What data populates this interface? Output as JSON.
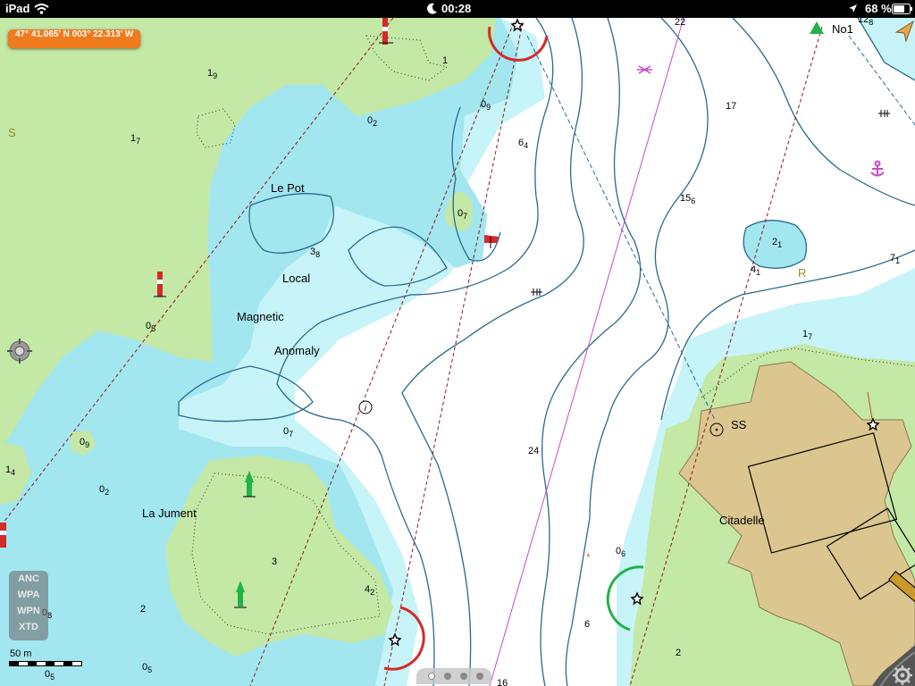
{
  "status_bar": {
    "device": "iPad",
    "time": "00:28",
    "battery": "68 %",
    "icons": [
      "wifi-icon",
      "moon-icon",
      "location-arrow-icon",
      "battery-icon"
    ]
  },
  "coordinates": "47° 41.065' N 003° 22.313' W",
  "map_labels": {
    "le_pot": "Le Pot",
    "local": "Local",
    "magnetic": "Magnetic",
    "anomaly": "Anomaly",
    "la_jument": "La Jument",
    "citadelle": "Citadelle",
    "ss": "SS",
    "no1": "No1",
    "s": "S",
    "r": "R"
  },
  "depths": [
    {
      "main": "1",
      "sub": "9"
    },
    {
      "main": "1",
      "sub": ""
    },
    {
      "main": "1",
      "sub": "7"
    },
    {
      "main": "0",
      "sub": "2"
    },
    {
      "main": "0",
      "sub": "9"
    },
    {
      "main": "6",
      "sub": "4"
    },
    {
      "main": "0",
      "sub": "7"
    },
    {
      "main": "3",
      "sub": "8"
    },
    {
      "main": "0",
      "sub": "5"
    },
    {
      "main": "0",
      "sub": "7"
    },
    {
      "main": "0",
      "sub": "9"
    },
    {
      "main": "1",
      "sub": "4"
    },
    {
      "main": "0",
      "sub": "2"
    },
    {
      "main": "3",
      "sub": ""
    },
    {
      "main": "4",
      "sub": "2"
    },
    {
      "main": "2",
      "sub": ""
    },
    {
      "main": "0",
      "sub": "8"
    },
    {
      "main": "0",
      "sub": "5"
    },
    {
      "main": "0",
      "sub": "5"
    },
    {
      "main": "22",
      "sub": ""
    },
    {
      "main": "12",
      "sub": "8"
    },
    {
      "main": "17",
      "sub": ""
    },
    {
      "main": "15",
      "sub": "6"
    },
    {
      "main": "2",
      "sub": "1"
    },
    {
      "main": "4",
      "sub": "1"
    },
    {
      "main": "7",
      "sub": "1"
    },
    {
      "main": "1",
      "sub": "7"
    },
    {
      "main": "24",
      "sub": ""
    },
    {
      "main": "0",
      "sub": "6"
    },
    {
      "main": "6",
      "sub": ""
    },
    {
      "main": "2",
      "sub": ""
    },
    {
      "main": "16",
      "sub": ""
    }
  ],
  "tools": [
    "ANC",
    "WPA",
    "WPN",
    "XTD"
  ],
  "scale_label": "50 m",
  "page_dots": {
    "count": 4,
    "active": 0
  },
  "colors": {
    "land": "#c4e8a6",
    "shallow_water": "#a2e6f0",
    "medium_water": "#c6f4f8",
    "deep_water": "#ffffff",
    "built_up": "#dcc690",
    "contour": "#2a6a8c",
    "coord_badge": "#f07a1e",
    "red_mark": "#d42a2a",
    "green_mark": "#22b24a",
    "magenta": "#c848c8"
  },
  "icons": {
    "crosshair": "crosshair-icon",
    "settings": "gear-icon",
    "anchorage": "anchor-icon",
    "wreck": "wreck-icon",
    "gps": "gps-arrow-icon",
    "info": "info-icon"
  }
}
